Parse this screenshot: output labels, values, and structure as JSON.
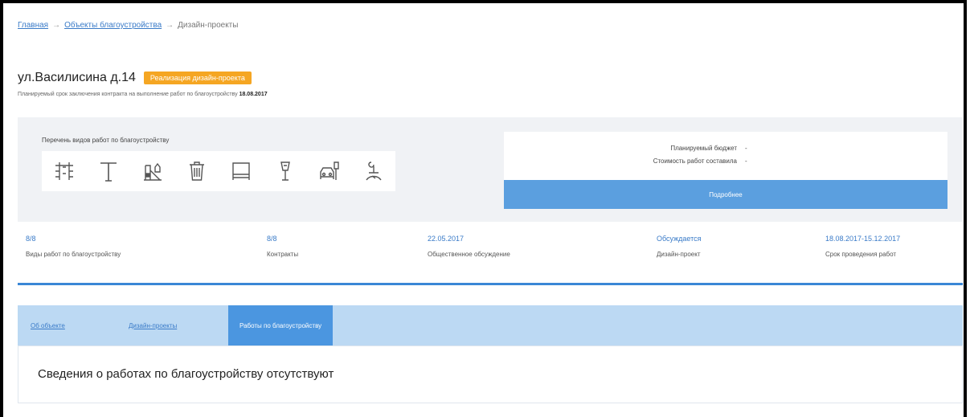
{
  "breadcrumb": {
    "home": "Главная",
    "objects": "Объекты благоустройства",
    "separator": "→",
    "current": "Дизайн-проекты"
  },
  "header": {
    "title": "ул.Василисина д.14",
    "badge": "Реализация дизайн-проекта",
    "plan_text": "Планируемый срок заключения контракта на выполнение работ по благоустройству",
    "plan_date": "18.08.2017"
  },
  "works": {
    "label": "Перечень видов работ по благоустройству",
    "icons": [
      "sidewalk-icon",
      "lamp-post-icon",
      "playground-icon",
      "trash-bin-icon",
      "bench-icon",
      "street-light-icon",
      "parking-icon",
      "landscaping-icon"
    ]
  },
  "budget": {
    "planned_label": "Планируемый бюджет",
    "planned_value": "-",
    "cost_label": "Стоимость работ составила",
    "cost_value": "-",
    "details_button": "Подробнее"
  },
  "stats": [
    {
      "value": "8/8",
      "label": "Виды работ по благоустройству"
    },
    {
      "value": "8/8",
      "label": "Контракты"
    },
    {
      "value": "22.05.2017",
      "label": "Общественное обсуждение"
    },
    {
      "value": "Обсуждается",
      "label": "Дизайн-проект"
    },
    {
      "value": "18.08.2017-15.12.2017",
      "label": "Срок проведения работ"
    }
  ],
  "tabs": [
    {
      "label": "Об объекте"
    },
    {
      "label": "Дизайн-проекты"
    },
    {
      "label": "Работы по благоустройству"
    }
  ],
  "content": {
    "message": "Сведения о работах по благоустройству отсутствуют"
  },
  "colors": {
    "accent": "#3a87d6",
    "badge": "#f5a623",
    "button": "#5b9fdf",
    "tab_bar": "#bcd9f3",
    "tab_active": "#4b96e0"
  }
}
